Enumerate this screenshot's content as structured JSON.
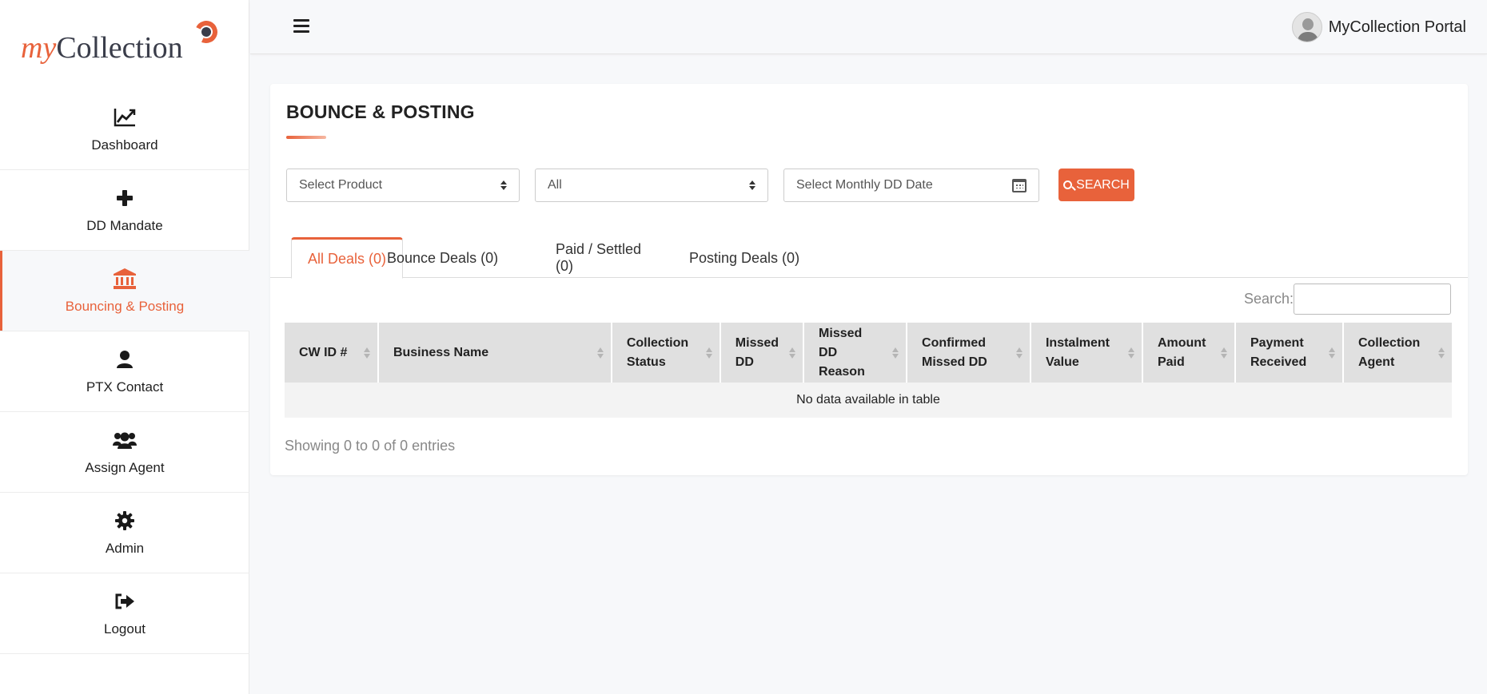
{
  "brand": {
    "my": "my",
    "collection": "Collection",
    "accent": "#e8623b",
    "dark": "#3a3d4a"
  },
  "sidebar": {
    "items": [
      {
        "label": "Dashboard",
        "icon": "chart-line-icon",
        "active": false
      },
      {
        "label": "DD Mandate",
        "icon": "plus-icon",
        "active": false
      },
      {
        "label": "Bouncing & Posting",
        "icon": "bank-icon",
        "active": true
      },
      {
        "label": "PTX Contact",
        "icon": "user-icon",
        "active": false
      },
      {
        "label": "Assign Agent",
        "icon": "users-icon",
        "active": false
      },
      {
        "label": "Admin",
        "icon": "gear-icon",
        "active": false
      },
      {
        "label": "Logout",
        "icon": "sign-out-icon",
        "active": false
      }
    ]
  },
  "header": {
    "user_name": "MyCollection Portal"
  },
  "page": {
    "title": "BOUNCE & POSTING",
    "filters": {
      "product": "Select Product",
      "status": "All",
      "date_placeholder": "Select Monthly DD Date"
    },
    "search_button": "SEARCH",
    "tabs": [
      {
        "label": "All Deals (0)",
        "active": true
      },
      {
        "label": "Bounce Deals (0)",
        "active": false
      },
      {
        "label": "Paid / Settled (0)",
        "active": false
      },
      {
        "label": "Posting Deals (0)",
        "active": false
      }
    ],
    "search_label": "Search:",
    "table": {
      "columns": [
        [
          "CW ID #"
        ],
        [
          "Business Name"
        ],
        [
          "Collection",
          "Status"
        ],
        [
          "Missed",
          "DD"
        ],
        [
          "Missed DD",
          "Reason"
        ],
        [
          "Confirmed",
          "Missed DD"
        ],
        [
          "Instalment",
          "Value"
        ],
        [
          "Amount",
          "Paid"
        ],
        [
          "Payment",
          "Received"
        ],
        [
          "Collection",
          "Agent"
        ]
      ],
      "empty_message": "No data available in table"
    },
    "info": "Showing 0 to 0 of 0 entries"
  }
}
